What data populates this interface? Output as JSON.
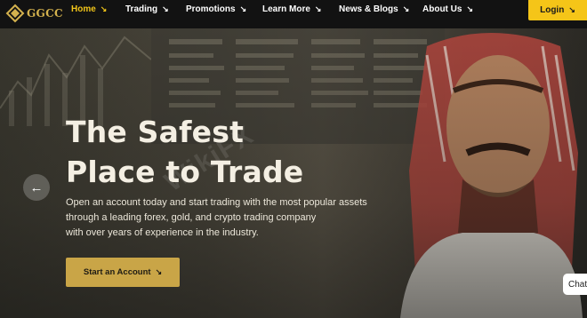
{
  "brand": {
    "name": "GGCC",
    "color": "#d4b24e"
  },
  "nav": {
    "items": [
      {
        "label": "Home",
        "active": true
      },
      {
        "label": "Trading"
      },
      {
        "label": "Promotions"
      },
      {
        "label": "Learn More"
      },
      {
        "label": "News & Blogs"
      },
      {
        "label": "About Us"
      }
    ],
    "arrow": "↘",
    "login": "Login",
    "active_color": "#f0c419",
    "login_bg": "#f5c518"
  },
  "hero": {
    "title_line1": "The Safest",
    "title_line2": "Place to Trade",
    "desc_line1": "Open an account today and start trading with the most popular assets",
    "desc_line2": "through a leading forex, gold, and crypto trading company",
    "desc_line3": "with over years of experience in the industry.",
    "cta": "Start an Account",
    "cta_bg": "#c9a547",
    "prev_icon": "arrow-left-icon",
    "watermark": "WikiFX"
  },
  "chat": {
    "label": "Chat"
  }
}
